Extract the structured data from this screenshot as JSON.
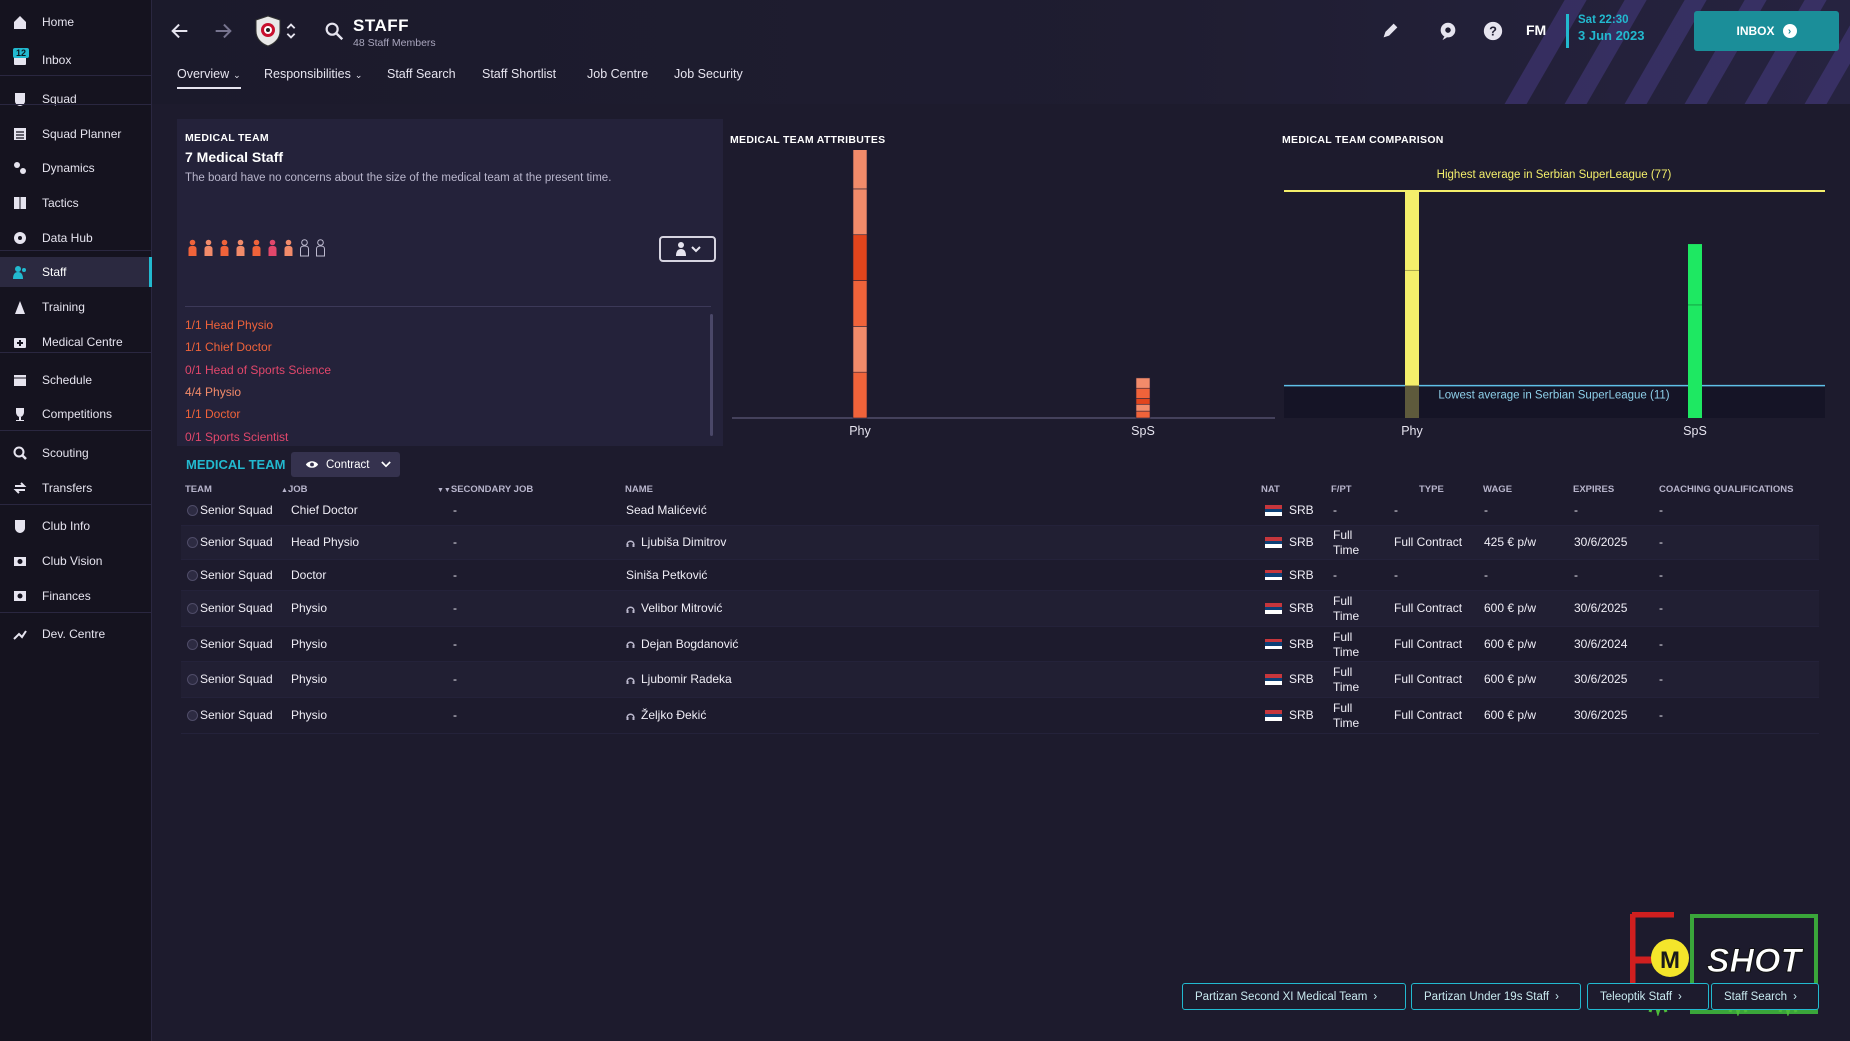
{
  "sidebar": {
    "inbox_badge": "12",
    "items": [
      {
        "label": "Home",
        "icon": "home-icon"
      },
      {
        "label": "Inbox",
        "icon": "inbox-icon"
      },
      {
        "label": "Squad",
        "icon": "squad-icon"
      },
      {
        "label": "Squad Planner",
        "icon": "squad-planner-icon"
      },
      {
        "label": "Dynamics",
        "icon": "dynamics-icon"
      },
      {
        "label": "Tactics",
        "icon": "tactics-icon"
      },
      {
        "label": "Data Hub",
        "icon": "data-hub-icon"
      },
      {
        "label": "Staff",
        "icon": "staff-icon"
      },
      {
        "label": "Training",
        "icon": "training-icon"
      },
      {
        "label": "Medical Centre",
        "icon": "medical-centre-icon"
      },
      {
        "label": "Schedule",
        "icon": "schedule-icon"
      },
      {
        "label": "Competitions",
        "icon": "trophy-icon"
      },
      {
        "label": "Scouting",
        "icon": "scouting-icon"
      },
      {
        "label": "Transfers",
        "icon": "transfers-icon"
      },
      {
        "label": "Club Info",
        "icon": "club-info-icon"
      },
      {
        "label": "Club Vision",
        "icon": "club-vision-icon"
      },
      {
        "label": "Finances",
        "icon": "finances-icon"
      },
      {
        "label": "Dev. Centre",
        "icon": "dev-centre-icon"
      }
    ],
    "active": "Staff"
  },
  "header": {
    "title": "STAFF",
    "subtitle": "48 Staff Members",
    "fm_logo": "FM",
    "date_time": "Sat 22:30",
    "date_day": "3 Jun 2023",
    "inbox_label": "INBOX"
  },
  "tabs": [
    {
      "label": "Overview"
    },
    {
      "label": "Responsibilities"
    },
    {
      "label": "Staff Search"
    },
    {
      "label": "Staff Shortlist"
    },
    {
      "label": "Job Centre"
    },
    {
      "label": "Job Security"
    }
  ],
  "summary": {
    "heading": "MEDICAL TEAM",
    "count_title": "7 Medical Staff",
    "description": "The board have no concerns about the size of the medical team at the present time.",
    "people_filled": 7,
    "people_empty": 2,
    "roles": [
      {
        "text": "1/1 Head Physio",
        "color": "#f0633a"
      },
      {
        "text": "1/1 Chief Doctor",
        "color": "#f0633a"
      },
      {
        "text": "0/1 Head of Sports Science",
        "color": "#e2476b"
      },
      {
        "text": "4/4 Physio",
        "color": "#f28b6a"
      },
      {
        "text": "1/1 Doctor",
        "color": "#f0633a"
      },
      {
        "text": "0/1 Sports Scientist",
        "color": "#e2476b"
      }
    ]
  },
  "attributes_chart": {
    "title": "MEDICAL TEAM ATTRIBUTES",
    "chart_data": {
      "type": "bar",
      "categories": [
        "Phy",
        "SpS"
      ],
      "stacked_segments": [
        {
          "category": "Phy",
          "segments": [
            {
              "value": 4,
              "color": "#f0633a"
            },
            {
              "value": 4,
              "color": "#f28b6a"
            },
            {
              "value": 4,
              "color": "#f0633a"
            },
            {
              "value": 4,
              "color": "#e2441c"
            },
            {
              "value": 4,
              "color": "#f28b6a"
            },
            {
              "value": 4,
              "color": "#f28b6a"
            }
          ]
        },
        {
          "category": "SpS",
          "segments": [
            {
              "value": 0.6,
              "color": "#f0633a"
            },
            {
              "value": 0.6,
              "color": "#f28b6a"
            },
            {
              "value": 0.5,
              "color": "#e2441c"
            },
            {
              "value": 0.9,
              "color": "#f0633a"
            },
            {
              "value": 0.9,
              "color": "#f28b6a"
            }
          ]
        }
      ],
      "ylim": [
        0,
        22
      ]
    }
  },
  "comparison_chart": {
    "title": "MEDICAL TEAM COMPARISON",
    "highest_label": "Highest average in Serbian SuperLeague (77)",
    "lowest_label": "Lowest average in Serbian SuperLeague (11)",
    "chart_data": {
      "type": "bar",
      "categories": [
        "Phy",
        "SpS"
      ],
      "values": [
        77,
        59
      ],
      "colors": [
        "#f4ef6b",
        "#1ee862"
      ],
      "reference_lines": {
        "highest": 77,
        "lowest": 11
      },
      "ylim": [
        0,
        77
      ]
    }
  },
  "table": {
    "title": "MEDICAL TEAM",
    "view_label": "Contract",
    "columns": [
      "TEAM",
      "JOB",
      "SECONDARY JOB",
      "NAME",
      "NAT",
      "F/PT",
      "TYPE",
      "WAGE",
      "EXPIRES",
      "COACHING QUALIFICATIONS"
    ],
    "rows": [
      {
        "team": "Senior Squad",
        "job": "Chief Doctor",
        "secondary": "-",
        "name": "Sead Malićević",
        "nat": "SRB",
        "fpt": "-",
        "type": "-",
        "wage": "-",
        "expires": "-",
        "qual": "-",
        "icon": false
      },
      {
        "team": "Senior Squad",
        "job": "Head Physio",
        "secondary": "-",
        "name": "Ljubiša Dimitrov",
        "nat": "SRB",
        "fpt": "Full Time",
        "type": "Full Contract",
        "wage": "425 € p/w",
        "expires": "30/6/2025",
        "qual": "-",
        "icon": true
      },
      {
        "team": "Senior Squad",
        "job": "Doctor",
        "secondary": "-",
        "name": "Siniša Petković",
        "nat": "SRB",
        "fpt": "-",
        "type": "-",
        "wage": "-",
        "expires": "-",
        "qual": "-",
        "icon": false
      },
      {
        "team": "Senior Squad",
        "job": "Physio",
        "secondary": "-",
        "name": "Velibor Mitrović",
        "nat": "SRB",
        "fpt": "Full Time",
        "type": "Full Contract",
        "wage": "600 € p/w",
        "expires": "30/6/2025",
        "qual": "-",
        "icon": true
      },
      {
        "team": "Senior Squad",
        "job": "Physio",
        "secondary": "-",
        "name": "Dejan Bogdanović",
        "nat": "SRB",
        "fpt": "Full Time",
        "type": "Full Contract",
        "wage": "600 € p/w",
        "expires": "30/6/2024",
        "qual": "-",
        "icon": true
      },
      {
        "team": "Senior Squad",
        "job": "Physio",
        "secondary": "-",
        "name": "Ljubomir Radeka",
        "nat": "SRB",
        "fpt": "Full Time",
        "type": "Full Contract",
        "wage": "600 € p/w",
        "expires": "30/6/2025",
        "qual": "-",
        "icon": true
      },
      {
        "team": "Senior Squad",
        "job": "Physio",
        "secondary": "-",
        "name": "Željko Đekić",
        "nat": "SRB",
        "fpt": "Full Time",
        "type": "Full Contract",
        "wage": "600 € p/w",
        "expires": "30/6/2025",
        "qual": "-",
        "icon": true
      }
    ]
  },
  "bottom_links": [
    {
      "label": "Partizan Second XI Medical Team"
    },
    {
      "label": "Partizan Under 19s Staff"
    },
    {
      "label": "Teleoptik Staff"
    },
    {
      "label": "Staff Search"
    }
  ],
  "watermark": {
    "text": "SHOT",
    "letter": "M"
  },
  "colors": {
    "accent": "#22b9cf",
    "sidebar_bg": "#15131f",
    "content_bg": "#1d1b2d"
  }
}
